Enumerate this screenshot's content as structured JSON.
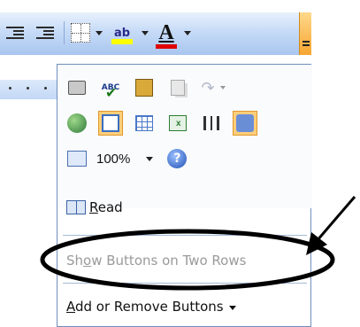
{
  "toolbar": {
    "buttons": [
      {
        "icon": "decrease-indent-icon"
      },
      {
        "icon": "increase-indent-icon"
      },
      {
        "icon": "borders-icon"
      },
      {
        "icon": "highlight-icon",
        "text": "ab"
      },
      {
        "icon": "font-color-icon",
        "text": "A"
      },
      {
        "icon": "toolbar-options-icon"
      }
    ],
    "colors": {
      "highlight": "#ffff00",
      "font_color": "#e00000",
      "toolbar_options": "#f7a531"
    }
  },
  "menu": {
    "icon_rows": [
      [
        "print-preview-icon",
        "spelling-grammar-icon",
        "research-icon",
        "copy-icon",
        "redo-icon"
      ],
      [
        "web-toolbar-icon",
        "tables-borders-icon",
        "insert-table-icon",
        "insert-excel-icon",
        "columns-icon",
        "drawing-icon"
      ],
      [
        "zoom-icon",
        "help-icon"
      ]
    ],
    "spell_icon_text": "ABC",
    "zoom": {
      "value": "100%"
    },
    "read": {
      "accel": "R",
      "rest": "ead"
    },
    "show_buttons": {
      "pre": "Sh",
      "accel": "o",
      "post": "w Buttons on Two Rows",
      "state": "disabled"
    },
    "add_remove": {
      "accel": "A",
      "rest": "dd or Remove Buttons"
    }
  }
}
